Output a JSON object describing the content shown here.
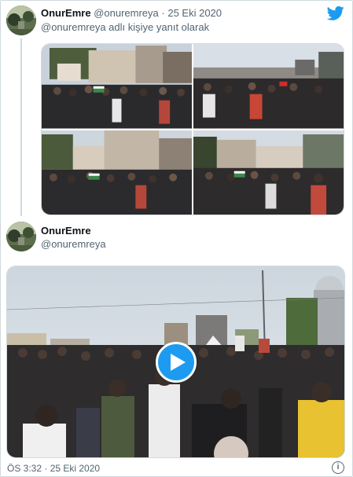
{
  "parent_tweet": {
    "display_name": "OnurEmre",
    "handle": "@onuremreya",
    "separator": " · ",
    "date": "25 Eki 2020",
    "reply_context": "@onuremreya adlı kişiye yanıt olarak",
    "media_count": 4
  },
  "main_tweet": {
    "display_name": "OnurEmre",
    "handle": "@onuremreya",
    "timestamp": "ÖS 3:32 · 25 Eki 2020"
  },
  "icons": {
    "brand": "twitter-bird-icon",
    "play": "play-icon",
    "info": "info-icon",
    "brand_color": "#1d9bf0"
  },
  "colors": {
    "muted_text": "#536471",
    "border": "#cfd9de",
    "accent": "#1d9bf0"
  }
}
